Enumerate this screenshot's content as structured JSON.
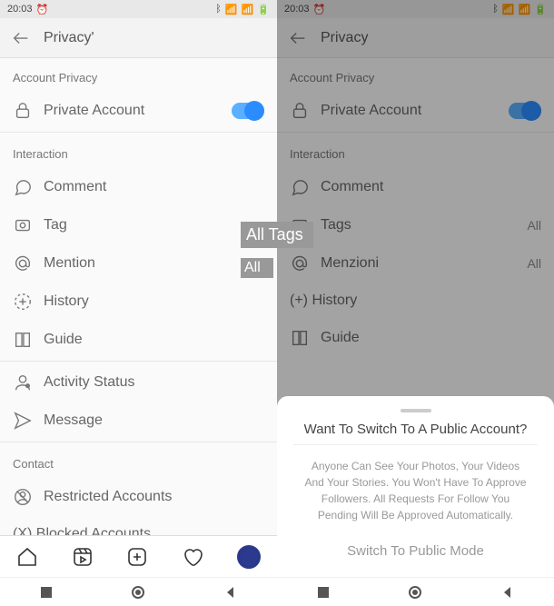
{
  "statusbar": {
    "time": "20:03"
  },
  "left": {
    "header": {
      "title": "Privacy'"
    },
    "sections": {
      "account_privacy_label": "Account Privacy",
      "private_account": "Private Account",
      "interaction_label": "Interaction",
      "comment": "Comment",
      "tag": "Tag",
      "mention": "Mention",
      "history": "History",
      "guide": "Guide",
      "activity_status": "Activity Status",
      "message": "Message",
      "contact_label": "Contact",
      "restricted": "Restricted Accounts",
      "blocked": "(X) Blocked Accounts"
    },
    "overlay": {
      "tags": "All Tags",
      "all": "All",
      "all2": "All"
    }
  },
  "right": {
    "header": {
      "title": "Privacy"
    },
    "sections": {
      "account_privacy_label": "Account Privacy",
      "private_account": "Private Account",
      "interaction_label": "Interaction",
      "comment": "Comment",
      "tag": "Tags",
      "tag_val": "All",
      "mention": "Menzioni",
      "mention_val": "All",
      "history": "(+) History",
      "guide": "Guide"
    },
    "sheet": {
      "title": "Want To Switch To A Public Account?",
      "body": "Anyone Can See Your Photos, Your Videos And Your Stories. You Won't Have To Approve Followers. All Requests For Follow You Pending Will Be Approved Automatically.",
      "action": "Switch To Public Mode"
    }
  }
}
